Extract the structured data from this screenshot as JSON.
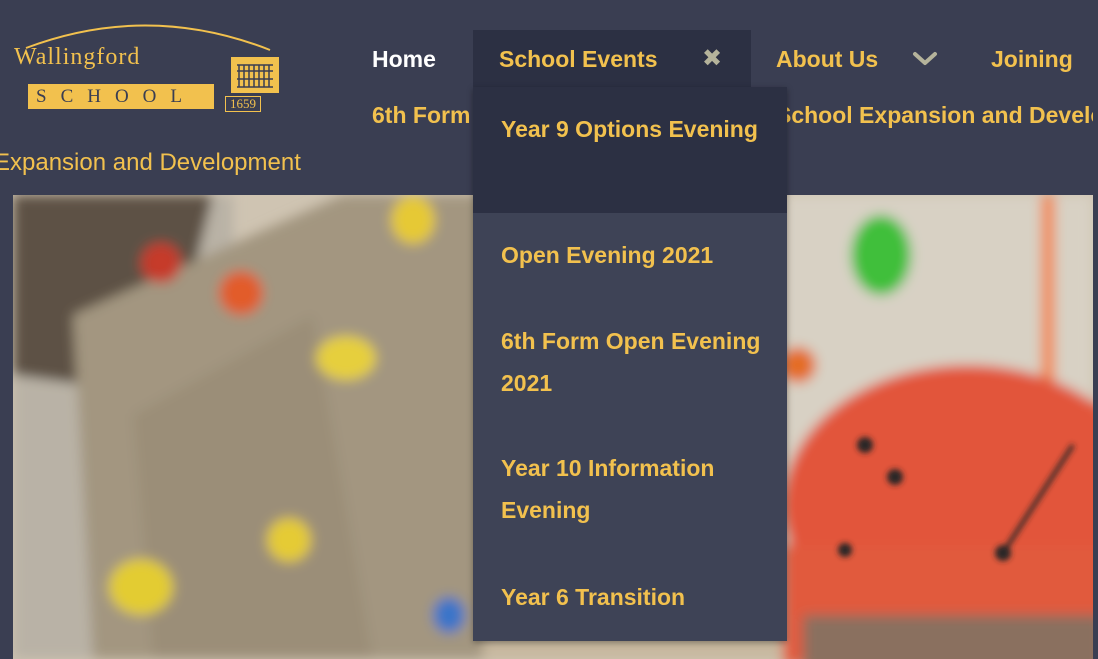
{
  "logo": {
    "word": "Wallingford",
    "school": "SCHOOL",
    "year": "1659"
  },
  "nav": {
    "home": "Home",
    "school_events": "School Events",
    "about_us": "About Us",
    "joining": "Joining",
    "sixth_form": "6th Form",
    "expansion": "School Expansion and Development"
  },
  "breadcrumb": "Expansion and Development",
  "dropdown": {
    "items": [
      {
        "label": "Year 9 Options Evening"
      },
      {
        "label": "Open Evening 2021"
      },
      {
        "label": "6th Form Open Evening 2021"
      },
      {
        "label": "Year 10 Information Evening"
      },
      {
        "label": "Year 6 Transition"
      }
    ]
  },
  "icons": {
    "close": "close-icon",
    "chevron": "chevron-down-icon"
  },
  "colors": {
    "background": "#3a3e52",
    "accent": "#f2c14e",
    "dropdown_bg": "#3e4356",
    "active_bg": "#2c3043"
  }
}
